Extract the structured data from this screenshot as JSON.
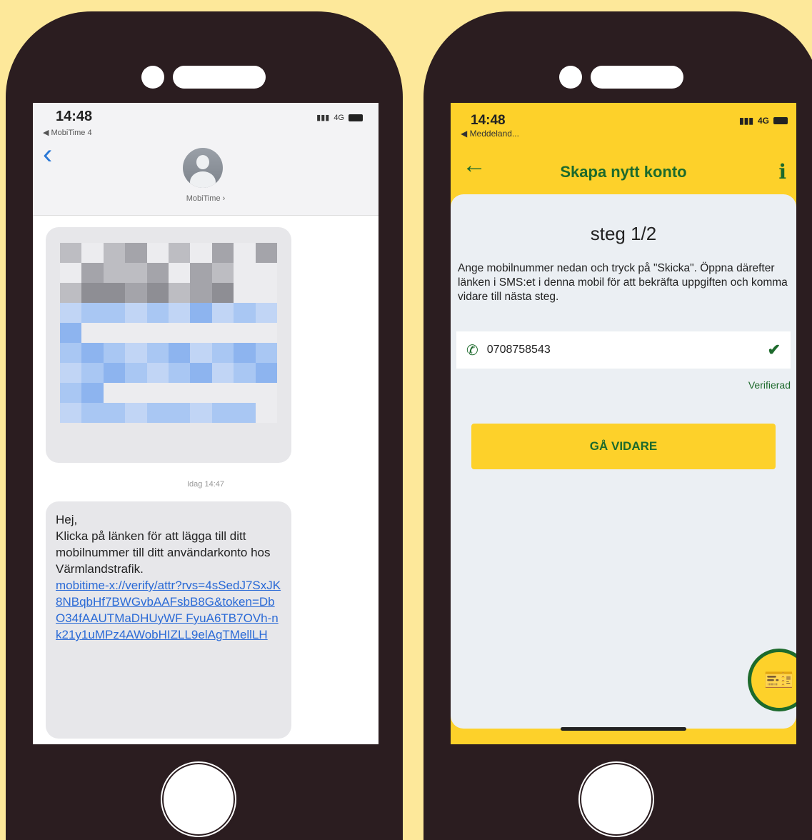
{
  "sms": {
    "time": "14:48",
    "back_app": "◀ MobiTime 4",
    "signal": "4G",
    "contact_name": "MobiTime ›",
    "timestamp": "Idag 14:47",
    "message_lines": [
      "Hej,",
      "Klicka på länken för att lägga till ditt mobilnummer till ditt användarkonto hos Värmlandstrafik."
    ],
    "link": "mobitime-x://verify/attr?rvs=4sSedJ7SxJK8NBqbHf7BWGvbAAFsbB8G&token=DbO34fAAUTMaDHUyWF FyuA6TB7OVh-nk21y1uMPz4AWobHIZLL9elAgTMellLH"
  },
  "app": {
    "time": "14:48",
    "back_app": "◀ Meddeland...",
    "signal": "4G",
    "title": "Skapa nytt konto",
    "info_label": "i",
    "step": "steg 1/2",
    "instructions": "Ange mobilnummer nedan och tryck på \"Skicka\". Öppna därefter länken i SMS:et i denna mobil för att bekräfta uppgiften och komma vidare till nästa steg.",
    "phone_number": "0708758543",
    "verified_label": "Verifierad",
    "continue_label": "GÅ VIDARE",
    "colors": {
      "brand_yellow": "#fdd12a",
      "brand_green": "#1d6a2c",
      "card_bg": "#ebeff3"
    }
  },
  "icons": {
    "phone": "phone-icon",
    "check": "check-icon",
    "back": "back-arrow-icon",
    "info": "info-icon",
    "ticket": "ticket-icon"
  }
}
